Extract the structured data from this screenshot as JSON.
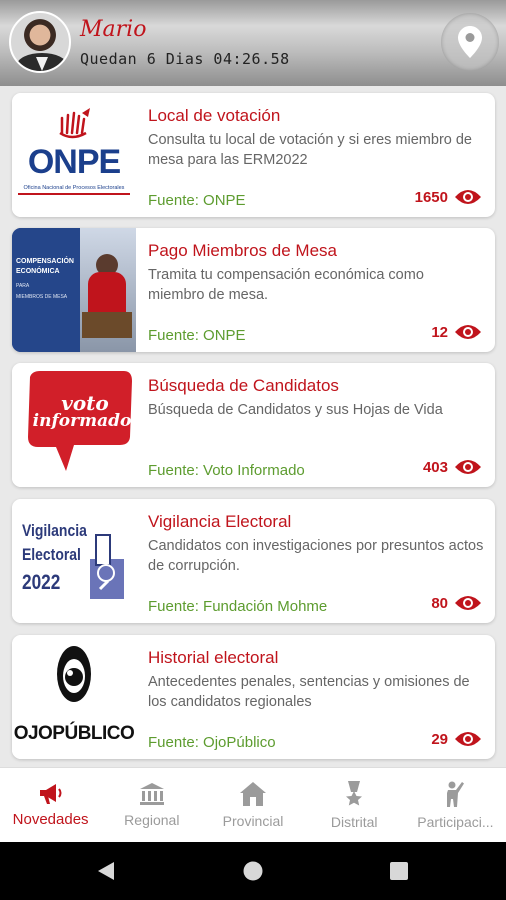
{
  "header": {
    "user_name": "Mario",
    "countdown": "Quedan 6 Dias 04:26.58",
    "location_icon": "location-pin-icon"
  },
  "colors": {
    "accent": "#c0141c",
    "source_green": "#5d9c2f"
  },
  "cards": [
    {
      "title": "Local de votación",
      "description": "Consulta tu local de votación y si eres miembro de mesa para las ERM2022",
      "source": "Fuente: ONPE",
      "views": "1650",
      "thumb": {
        "logo": "ONPE",
        "caption": "Oficina Nacional de Procesos Electorales"
      }
    },
    {
      "title": "Pago Miembros de Mesa",
      "description": "Tramita tu compensación económica como miembro de mesa.",
      "source": "Fuente: ONPE",
      "views": "12",
      "thumb": {
        "line1": "COMPENSACIÓN",
        "line2": "ECONÓMICA",
        "line3": "PARA",
        "line4": "MIEMBROS DE MESA"
      }
    },
    {
      "title": "Búsqueda de Candidatos",
      "description": "Búsqueda de Candidatos y sus Hojas de Vida",
      "source": "Fuente: Voto Informado",
      "views": "403",
      "thumb": {
        "line1": "voto",
        "line2": "informado"
      }
    },
    {
      "title": "Vigilancia Electoral",
      "description": "Candidatos con investigaciones por presuntos actos de corrupción.",
      "source": "Fuente: Fundación Mohme",
      "views": "80",
      "thumb": {
        "line1": "Vigilancia",
        "line2": "Electoral",
        "line3": "2022"
      }
    },
    {
      "title": "Historial electoral",
      "description": "Antecedentes penales, sentencias y omisiones de los candidatos regionales",
      "source": "Fuente: OjoPúblico",
      "views": "29",
      "thumb": {
        "logo": "OJOPÚBLICO"
      }
    }
  ],
  "nav": [
    {
      "label": "Novedades",
      "icon": "megaphone-icon",
      "active": true
    },
    {
      "label": "Regional",
      "icon": "bank-icon",
      "active": false
    },
    {
      "label": "Provincial",
      "icon": "house-icon",
      "active": false
    },
    {
      "label": "Distrital",
      "icon": "medal-icon",
      "active": false
    },
    {
      "label": "Participaci...",
      "icon": "person-raising-hand-icon",
      "active": false
    }
  ],
  "system_nav": [
    "back-icon",
    "home-icon",
    "recents-icon"
  ]
}
